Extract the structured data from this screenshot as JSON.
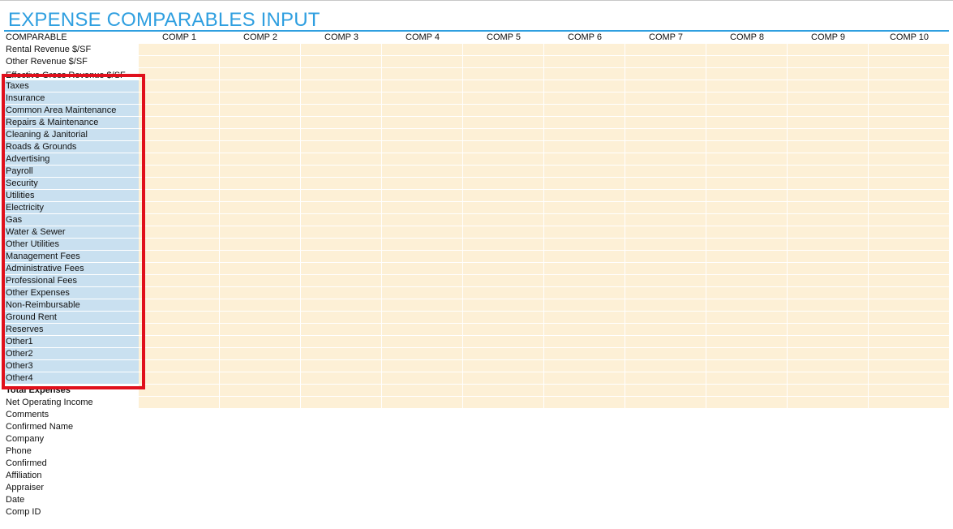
{
  "sheet": {
    "title": "EXPENSE COMPARABLES INPUT",
    "first_header": "COMPARABLE",
    "comp_headers": [
      "COMP 1",
      "COMP 2",
      "COMP 3",
      "COMP 4",
      "COMP 5",
      "COMP 6",
      "COMP 7",
      "COMP 8",
      "COMP 9",
      "COMP 10"
    ],
    "revenue_rows": [
      "Rental Revenue $/SF",
      "Other Revenue $/SF",
      "Effective Gross Revenue $/SF"
    ],
    "expense_rows": [
      "Taxes",
      "Insurance",
      "Common Area Maintenance",
      "Repairs & Maintenance",
      "Cleaning & Janitorial",
      "Roads & Grounds",
      "Advertising",
      "Payroll",
      "Security",
      "Utilities",
      "Electricity",
      "Gas",
      "Water & Sewer",
      "Other Utilities",
      "Management Fees",
      "Administrative Fees",
      "Professional Fees",
      "Other Expenses",
      "Non-Reimbursable",
      "Ground Rent",
      "Reserves",
      "Other1",
      "Other2",
      "Other3",
      "Other4"
    ],
    "total_row": "Total Expenses",
    "noi_row": "Net Operating Income",
    "info_rows": [
      "Comments",
      "Confirmed Name",
      "Company",
      "Phone",
      "Confirmed",
      "Affiliation",
      "Appraiser",
      "Date",
      "Comp ID"
    ]
  },
  "colors": {
    "title": "#2f9fe0",
    "selected_label_fill": "#c9e0f0",
    "input_fill": "#fdf0d6",
    "selection_border": "#e0101c"
  }
}
